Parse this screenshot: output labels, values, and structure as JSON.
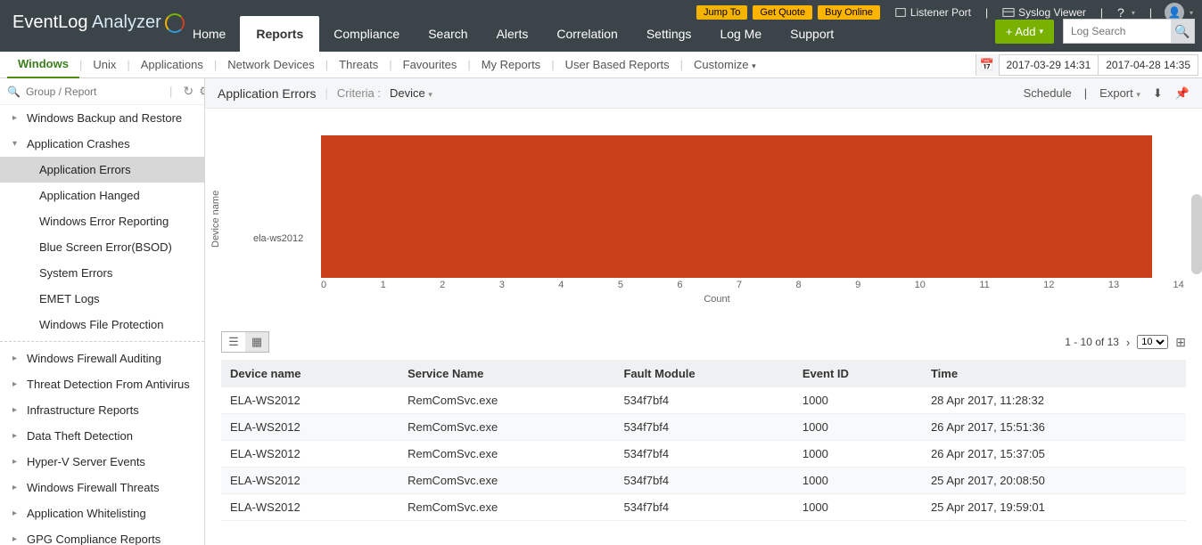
{
  "brand": {
    "name1": "EventLog ",
    "name2": "Analyzer"
  },
  "top_pills": {
    "jump": "Jump To",
    "quote": "Get Quote",
    "buy": "Buy Online"
  },
  "top_links": {
    "listener": "Listener Port",
    "syslog": "Syslog Viewer"
  },
  "add_btn": "+ Add",
  "log_search_placeholder": "Log Search",
  "mainnav": [
    "Home",
    "Reports",
    "Compliance",
    "Search",
    "Alerts",
    "Correlation",
    "Settings",
    "Log Me",
    "Support"
  ],
  "mainnav_active": 1,
  "subnav": [
    "Windows",
    "Unix",
    "Applications",
    "Network Devices",
    "Threats",
    "Favourites",
    "My Reports",
    "User Based Reports"
  ],
  "subnav_active": 0,
  "customize_label": "Customize",
  "date_range": {
    "from": "2017-03-29 14:31",
    "to": "2017-04-28 14:35"
  },
  "side_search_placeholder": "Group / Report",
  "tree": {
    "row0": "Windows Backup and Restore",
    "parent": "Application Crashes",
    "subs": [
      "Application Errors",
      "Application Hanged",
      "Windows Error Reporting",
      "Blue Screen Error(BSOD)",
      "System Errors",
      "EMET Logs",
      "Windows File Protection"
    ],
    "subs_active": 0,
    "rest": [
      "Windows Firewall Auditing",
      "Threat Detection From Antivirus",
      "Infrastructure Reports",
      "Data Theft Detection",
      "Hyper-V Server Events",
      "Windows Firewall Threats",
      "Application Whitelisting",
      "GPG Compliance Reports"
    ]
  },
  "report_header": {
    "title": "Application Errors",
    "criteria_label": "Criteria :",
    "criteria_value": "Device",
    "schedule": "Schedule",
    "export": "Export"
  },
  "chart_data": {
    "type": "bar",
    "orientation": "horizontal",
    "ylabel": "Device name",
    "xlabel": "Count",
    "categories": [
      "ela-ws2012"
    ],
    "values": [
      13
    ],
    "xticks": [
      0,
      1,
      2,
      3,
      4,
      5,
      6,
      7,
      8,
      9,
      10,
      11,
      12,
      13,
      14
    ],
    "xlim": [
      0,
      14
    ],
    "color": "#c9401b"
  },
  "paging": {
    "range": "1 - 10 of 13",
    "page_size": "10"
  },
  "table": {
    "columns": [
      "Device name",
      "Service Name",
      "Fault Module",
      "Event ID",
      "Time"
    ],
    "rows": [
      [
        "ELA-WS2012",
        "RemComSvc.exe",
        "534f7bf4",
        "1000",
        "28 Apr 2017, 11:28:32"
      ],
      [
        "ELA-WS2012",
        "RemComSvc.exe",
        "534f7bf4",
        "1000",
        "26 Apr 2017, 15:51:36"
      ],
      [
        "ELA-WS2012",
        "RemComSvc.exe",
        "534f7bf4",
        "1000",
        "26 Apr 2017, 15:37:05"
      ],
      [
        "ELA-WS2012",
        "RemComSvc.exe",
        "534f7bf4",
        "1000",
        "25 Apr 2017, 20:08:50"
      ],
      [
        "ELA-WS2012",
        "RemComSvc.exe",
        "534f7bf4",
        "1000",
        "25 Apr 2017, 19:59:01"
      ]
    ]
  }
}
